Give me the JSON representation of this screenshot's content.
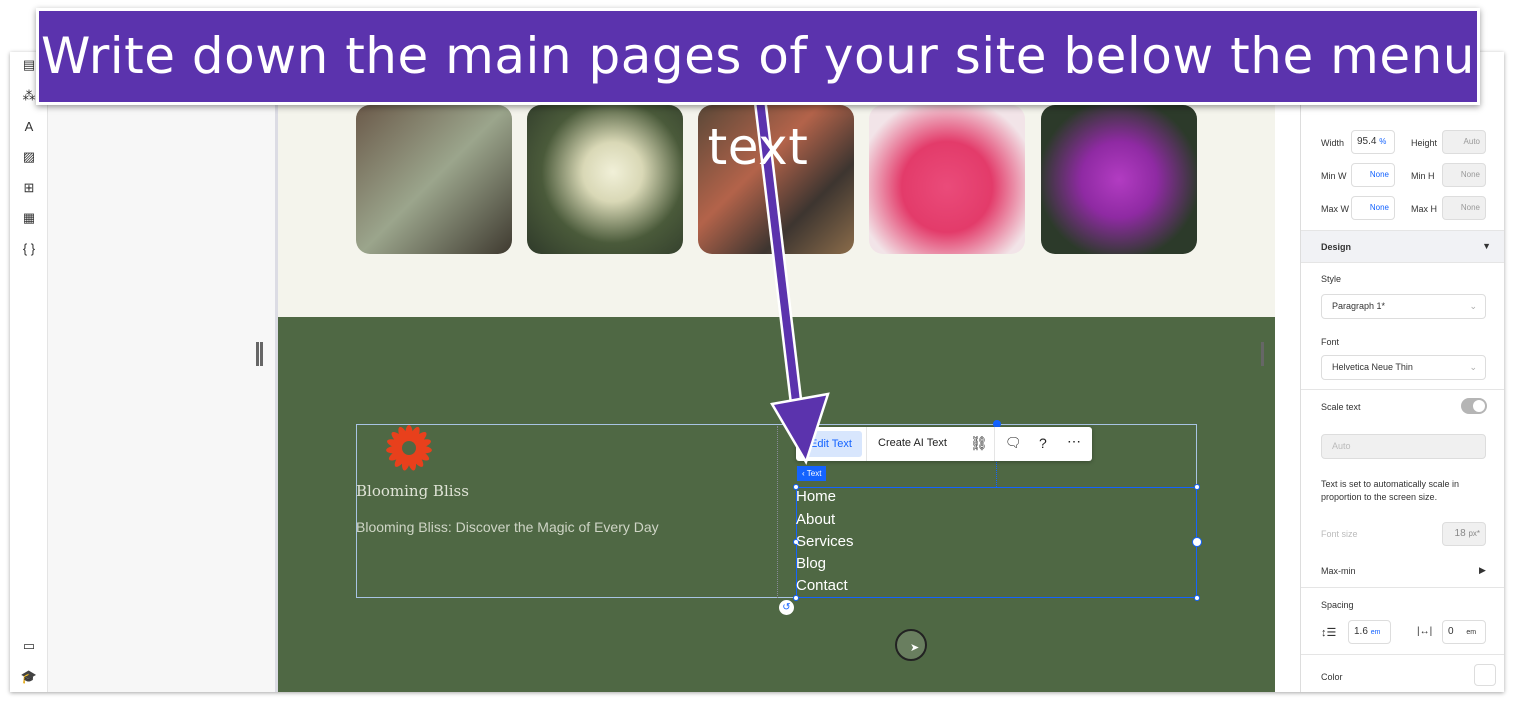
{
  "banner": {
    "text": "Write down the main pages of your site below the menu text"
  },
  "sidebar": {
    "icons": [
      "pages-icon",
      "components-icon",
      "theme-icon",
      "media-icon",
      "apps-icon",
      "cms-icon",
      "code-icon",
      "chat-icon",
      "learn-icon"
    ]
  },
  "site": {
    "brand": "Blooming Bliss",
    "tagline": "Blooming Bliss: Discover the Magic of Every Day",
    "menu": [
      "Home",
      "About",
      "Services",
      "Blog",
      "Contact"
    ],
    "logo_color": "#e8401c",
    "footer_color": "#4f6844"
  },
  "toolbar": {
    "edit_text": "Edit Text",
    "create_ai_text": "Create AI Text",
    "tag": "Text"
  },
  "inspector": {
    "size": {
      "width_label": "Width",
      "width_value": "95.4",
      "width_unit": "%",
      "height_label": "Height",
      "height_value": "Auto",
      "minw_label": "Min W",
      "minw_value": "None",
      "minh_label": "Min H",
      "minh_value": "None",
      "maxw_label": "Max W",
      "maxw_value": "None",
      "maxh_label": "Max H",
      "maxh_value": "None"
    },
    "design_label": "Design",
    "style_label": "Style",
    "style_value": "Paragraph 1*",
    "font_label": "Font",
    "font_value": "Helvetica Neue Thin",
    "scale_label": "Scale text",
    "scale_on": true,
    "scale_select": "Auto",
    "scale_note": "Text is set to automatically scale in proportion to the screen size.",
    "font_size_label": "Font size",
    "font_size_value": "18",
    "font_size_unit": "px*",
    "maxmin_label": "Max-min",
    "spacing_label": "Spacing",
    "line_height": "1.6",
    "line_unit": "em",
    "letter_spacing": "0",
    "letter_unit": "em",
    "color_label": "Color"
  },
  "accent": "#1463ff",
  "annotation_color": "#5b33ad"
}
